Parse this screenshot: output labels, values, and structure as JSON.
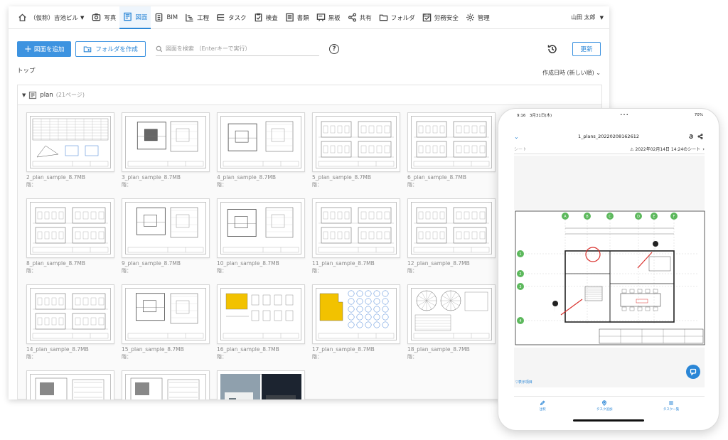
{
  "nav": {
    "project": "（仮称）吉池ビル",
    "items": [
      {
        "label": "写真",
        "icon": "photo-icon",
        "active": false
      },
      {
        "label": "図面",
        "icon": "drawing-icon",
        "active": true
      },
      {
        "label": "BIM",
        "icon": "bim-icon",
        "active": false
      },
      {
        "label": "工程",
        "icon": "schedule-icon",
        "active": false
      },
      {
        "label": "タスク",
        "icon": "task-icon",
        "active": false
      },
      {
        "label": "検査",
        "icon": "inspection-icon",
        "active": false
      },
      {
        "label": "書類",
        "icon": "document-icon",
        "active": false
      },
      {
        "label": "黒板",
        "icon": "blackboard-icon",
        "active": false
      },
      {
        "label": "共有",
        "icon": "share-icon",
        "active": false
      },
      {
        "label": "フォルダ",
        "icon": "folder-icon",
        "active": false
      },
      {
        "label": "労務安全",
        "icon": "safety-icon",
        "active": false
      },
      {
        "label": "管理",
        "icon": "gear-icon",
        "active": false
      }
    ],
    "user": "山田 太郎"
  },
  "toolbar": {
    "add_label": "図面を追加",
    "create_folder_label": "フォルダを作成",
    "search_placeholder": "図面を検索 （Enterキーで実行）",
    "help_label": "?",
    "refresh_label": "更新"
  },
  "breadcrumb": "トップ",
  "sort_label": "作成日時 (新しい順) ⌄",
  "folder": {
    "name": "plan",
    "count": "(21ページ)"
  },
  "files": [
    {
      "name": "2_plan_sample_8.7MB",
      "meta": "階："
    },
    {
      "name": "3_plan_sample_8.7MB",
      "meta": "階："
    },
    {
      "name": "4_plan_sample_8.7MB",
      "meta": "階："
    },
    {
      "name": "5_plan_sample_8.7MB",
      "meta": "階："
    },
    {
      "name": "6_plan_sample_8.7MB",
      "meta": "階："
    },
    {
      "name": "8_plan_sample_8.7MB",
      "meta": "階："
    },
    {
      "name": "9_plan_sample_8.7MB",
      "meta": "階："
    },
    {
      "name": "10_plan_sample_8.7MB",
      "meta": "階："
    },
    {
      "name": "11_plan_sample_8.7MB",
      "meta": "階："
    },
    {
      "name": "12_plan_sample_8.7MB",
      "meta": "階："
    },
    {
      "name": "14_plan_sample_8.7MB",
      "meta": "階："
    },
    {
      "name": "15_plan_sample_8.7MB",
      "meta": "階："
    },
    {
      "name": "16_plan_sample_8.7MB",
      "meta": "階："
    },
    {
      "name": "17_plan_sample_8.7MB",
      "meta": "階："
    },
    {
      "name": "18_plan_sample_8.7MB",
      "meta": "階："
    },
    {
      "name": "",
      "meta": ""
    },
    {
      "name": "",
      "meta": ""
    },
    {
      "name": "",
      "meta": ""
    }
  ],
  "phone": {
    "time": "9:16　3月31日(木)",
    "dots": "•••",
    "battery": "70%",
    "title": "1_plans_20220208162612",
    "sheet_label": "シート",
    "sheet_date": "⚠ 2022年02月14日 14:24のシート",
    "filter_label": "▽表示項目",
    "tabs": [
      {
        "label": "注釈",
        "icon": "pen-icon"
      },
      {
        "label": "タスク追加",
        "icon": "pin-icon"
      },
      {
        "label": "タスク一覧",
        "icon": "list-icon"
      }
    ],
    "grid_markers_top": [
      "A",
      "B",
      "C",
      "D",
      "E",
      "F"
    ],
    "grid_markers_left": [
      "1",
      "2",
      "3",
      "4"
    ],
    "accent": "#2a86d6"
  }
}
